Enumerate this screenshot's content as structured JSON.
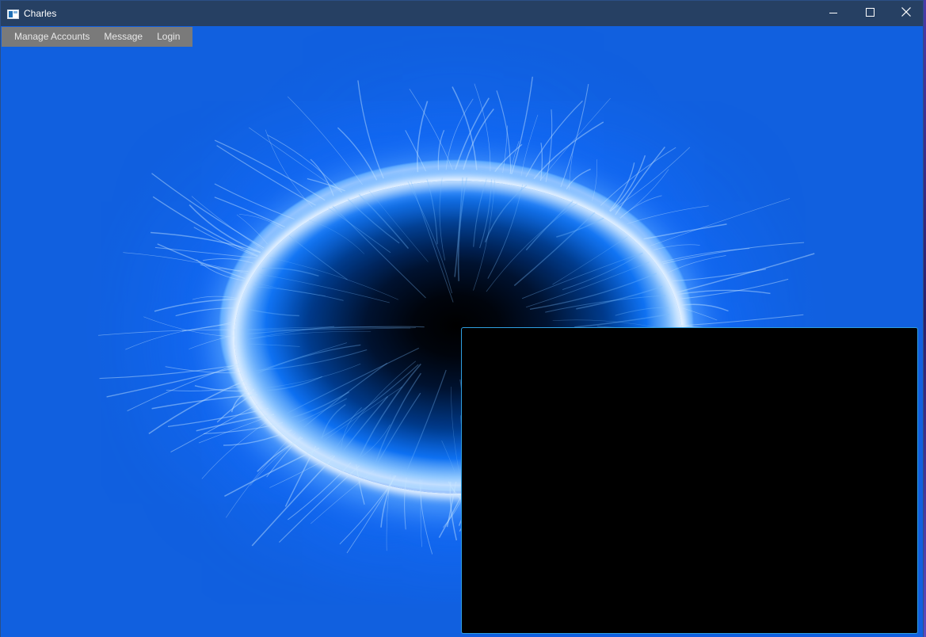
{
  "window": {
    "title": "Charles",
    "icon": "app-window-icon",
    "controls": {
      "minimize_icon": "minimize-icon",
      "maximize_icon": "maximize-icon",
      "close_icon": "close-icon"
    }
  },
  "menu": {
    "items": [
      {
        "label": "Manage Accounts"
      },
      {
        "label": "Message"
      },
      {
        "label": "Login"
      }
    ]
  },
  "background": {
    "type": "blue-plasma-ring-wallpaper"
  },
  "panel": {
    "color": "#000000",
    "border_color": "#2f9fe0"
  },
  "colors": {
    "titlebar": "#264063",
    "menubar": "#7a7a7a",
    "accent": "#2f9fe0"
  }
}
